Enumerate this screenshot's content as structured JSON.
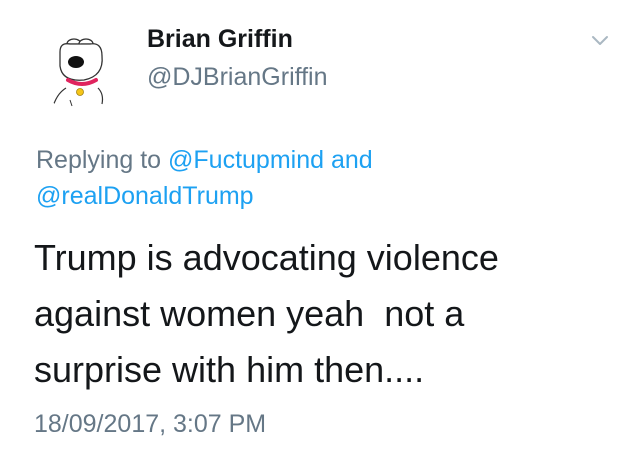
{
  "tweet": {
    "author": {
      "display_name": "Brian Griffin",
      "handle": "@DJBrianGriffin",
      "avatar_icon": "brian-griffin-dog-avatar"
    },
    "menu_icon": "chevron-down-icon",
    "reply_context": {
      "prefix": "Replying to",
      "mention_1": "@Fuctupmind",
      "conjunction": "and",
      "mention_2": "@realDonaldTrump"
    },
    "text": {
      "line_1": "Trump is advocating violence",
      "line_2": "against women yeah  not a",
      "line_3": "surprise with him then...."
    },
    "timestamp": "18/09/2017, 3:07 PM"
  },
  "colors": {
    "text_primary": "#14171a",
    "text_secondary": "#657786",
    "link": "#1da1f2",
    "collar": "#e0245e"
  }
}
